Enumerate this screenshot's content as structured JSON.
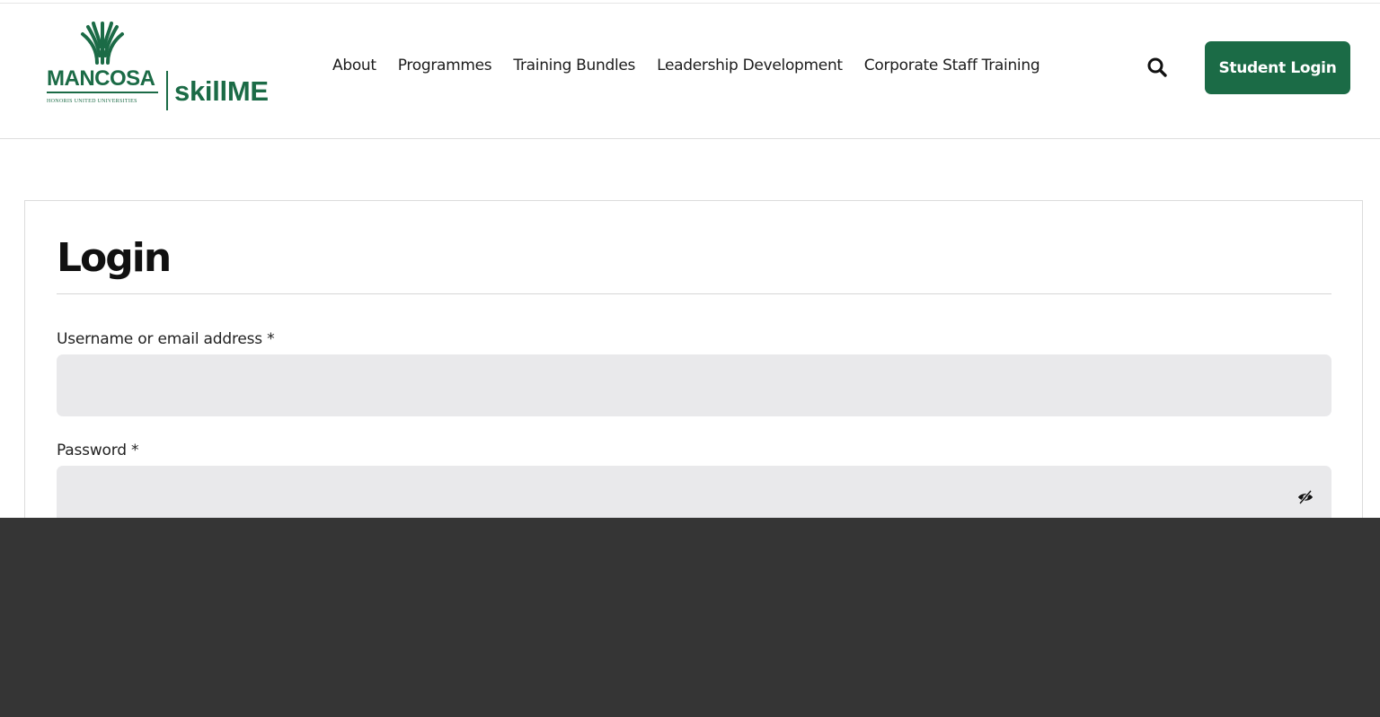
{
  "brand": {
    "name": "MANCOSA",
    "subline": "HONORIS UNITED UNIVERSITIES",
    "product": "skillME",
    "accent_color": "#1b6b46"
  },
  "nav": {
    "items": [
      {
        "label": "About"
      },
      {
        "label": "Programmes"
      },
      {
        "label": "Training Bundles"
      },
      {
        "label": "Leadership Development"
      },
      {
        "label": "Corporate Staff Training"
      }
    ],
    "search_icon": "search-icon",
    "student_login_label": "Student Login"
  },
  "login": {
    "title": "Login",
    "username_label": "Username or email address *",
    "username_value": "",
    "password_label": "Password *",
    "password_value": "",
    "password_toggle_icon": "eye-slash-icon"
  },
  "colors": {
    "input_bg": "#e9e9eb",
    "footer_bg": "#353535"
  }
}
